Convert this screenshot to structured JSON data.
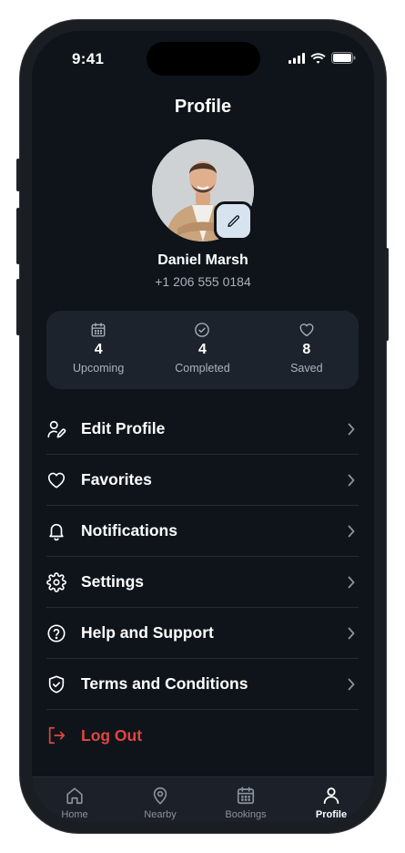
{
  "status_bar": {
    "time": "9:41"
  },
  "header": {
    "title": "Profile"
  },
  "user": {
    "name": "Daniel Marsh",
    "phone": "+1 206 555 0184"
  },
  "stats": [
    {
      "icon": "calendar-icon",
      "value": "4",
      "label": "Upcoming"
    },
    {
      "icon": "check-circle-icon",
      "value": "4",
      "label": "Completed"
    },
    {
      "icon": "heart-icon",
      "value": "8",
      "label": "Saved"
    }
  ],
  "menu": [
    {
      "icon": "user-edit-icon",
      "label": "Edit Profile"
    },
    {
      "icon": "heart-icon",
      "label": "Favorites"
    },
    {
      "icon": "bell-icon",
      "label": "Notifications"
    },
    {
      "icon": "gear-icon",
      "label": "Settings"
    },
    {
      "icon": "help-icon",
      "label": "Help and Support"
    },
    {
      "icon": "shield-check-icon",
      "label": "Terms and Conditions"
    }
  ],
  "logout": {
    "icon": "logout-icon",
    "label": "Log Out",
    "color": "#e0463f"
  },
  "tabs": [
    {
      "icon": "home-icon",
      "label": "Home",
      "active": false
    },
    {
      "icon": "map-pin-icon",
      "label": "Nearby",
      "active": false
    },
    {
      "icon": "calendar-icon",
      "label": "Bookings",
      "active": false
    },
    {
      "icon": "user-icon",
      "label": "Profile",
      "active": true
    }
  ],
  "colors": {
    "background": "#0f141b",
    "card": "#1d232c",
    "accent_danger": "#e0463f",
    "edit_button": "#d7e3ee"
  }
}
